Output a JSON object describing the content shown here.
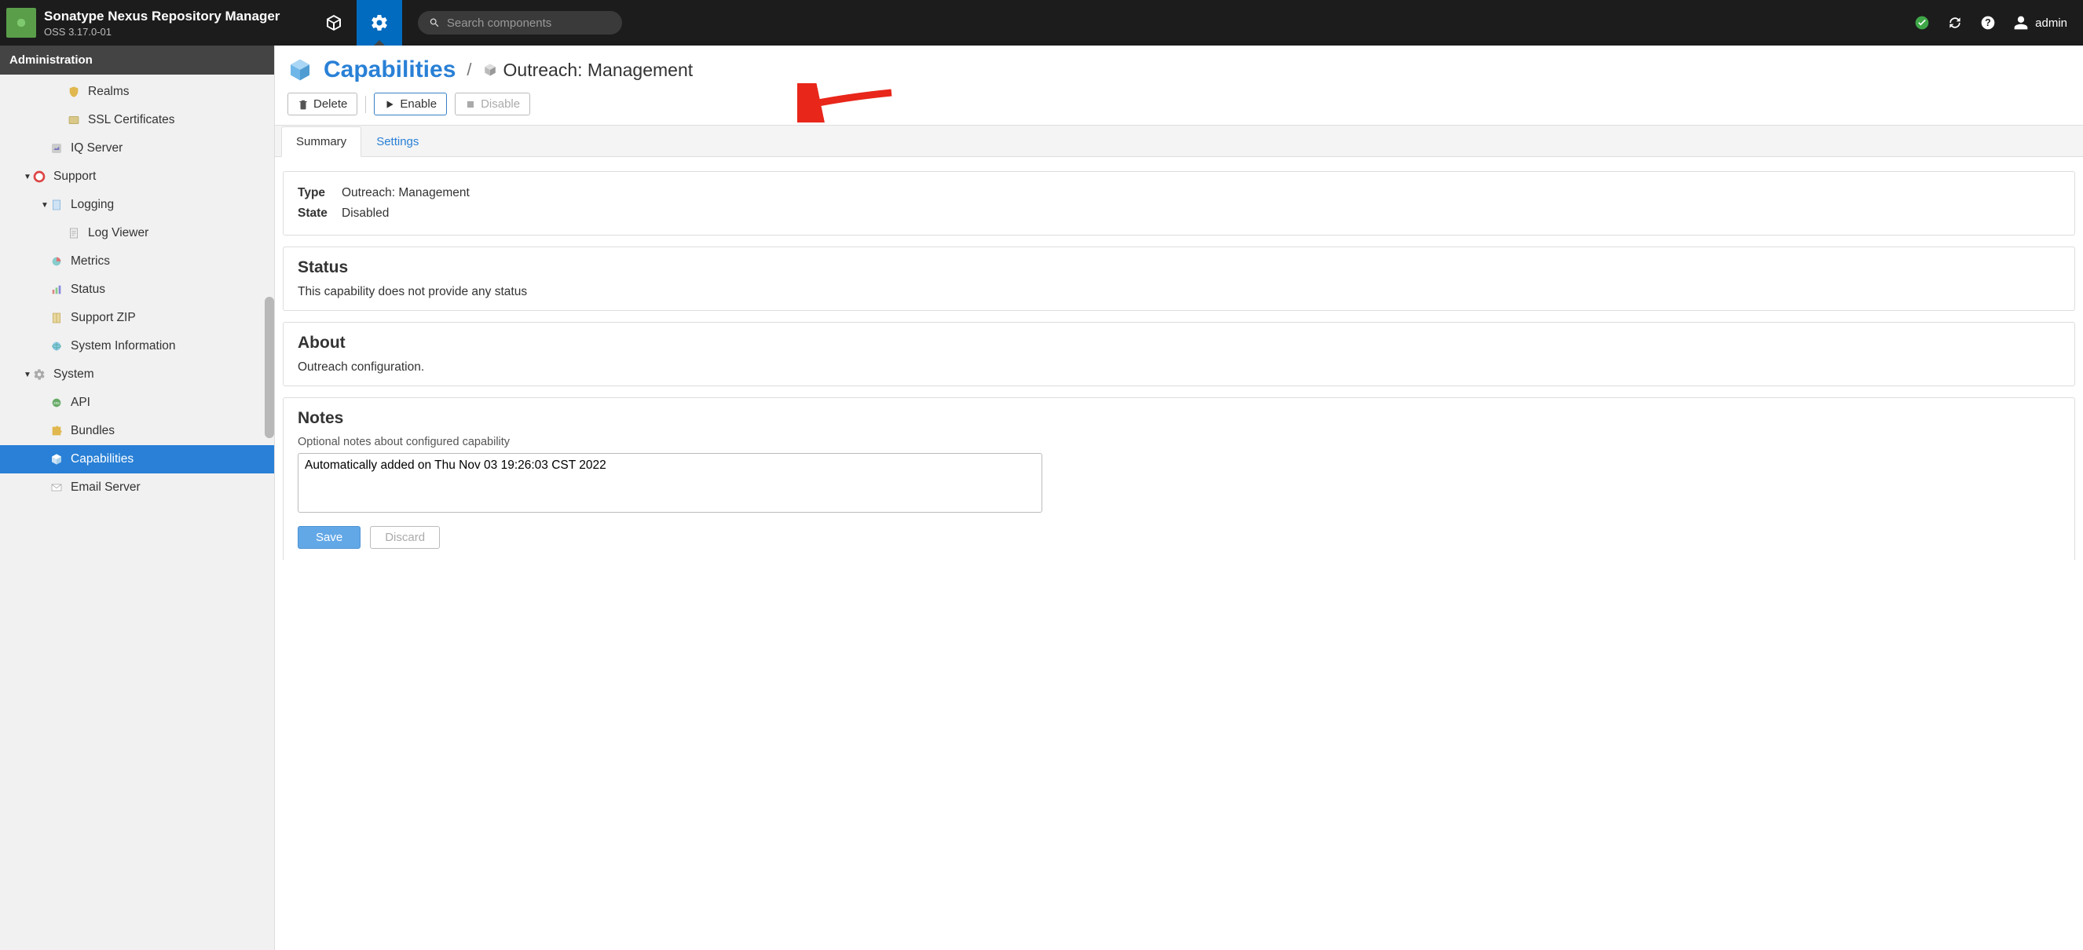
{
  "header": {
    "product_name": "Sonatype Nexus Repository Manager",
    "version": "OSS 3.17.0-01",
    "search_placeholder": "Search components",
    "username": "admin"
  },
  "sidebar": {
    "title": "Administration",
    "items": [
      {
        "label": "Realms",
        "indent": 3,
        "icon": "shield"
      },
      {
        "label": "SSL Certificates",
        "indent": 3,
        "icon": "cert"
      },
      {
        "label": "IQ Server",
        "indent": 2,
        "icon": "iq"
      },
      {
        "label": "Support",
        "indent": 1,
        "icon": "lifesaver",
        "arrow": "▼"
      },
      {
        "label": "Logging",
        "indent": 2,
        "icon": "doc",
        "arrow": "▼"
      },
      {
        "label": "Log Viewer",
        "indent": 3,
        "icon": "docview"
      },
      {
        "label": "Metrics",
        "indent": 2,
        "icon": "pie"
      },
      {
        "label": "Status",
        "indent": 2,
        "icon": "bars"
      },
      {
        "label": "Support ZIP",
        "indent": 2,
        "icon": "zip"
      },
      {
        "label": "System Information",
        "indent": 2,
        "icon": "globe"
      },
      {
        "label": "System",
        "indent": 1,
        "icon": "gear",
        "arrow": "▼"
      },
      {
        "label": "API",
        "indent": 2,
        "icon": "api"
      },
      {
        "label": "Bundles",
        "indent": 2,
        "icon": "puzzle"
      },
      {
        "label": "Capabilities",
        "indent": 2,
        "icon": "cube3",
        "selected": true
      },
      {
        "label": "Email Server",
        "indent": 2,
        "icon": "mail"
      }
    ]
  },
  "breadcrumb": {
    "root": "Capabilities",
    "current": "Outreach: Management"
  },
  "toolbar": {
    "delete_label": "Delete",
    "enable_label": "Enable",
    "disable_label": "Disable"
  },
  "tabs": {
    "summary": "Summary",
    "settings": "Settings"
  },
  "summary": {
    "type_label": "Type",
    "type_value": "Outreach: Management",
    "state_label": "State",
    "state_value": "Disabled",
    "status_heading": "Status",
    "status_text": "This capability does not provide any status",
    "about_heading": "About",
    "about_text": "Outreach configuration.",
    "notes_heading": "Notes",
    "notes_help": "Optional notes about configured capability",
    "notes_value": "Automatically added on Thu Nov 03 19:26:03 CST 2022",
    "save_label": "Save",
    "discard_label": "Discard"
  }
}
